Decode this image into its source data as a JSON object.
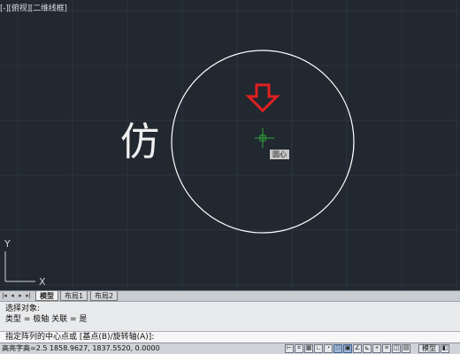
{
  "viewport": {
    "label": "[-][俯视][二维线框]",
    "side_text": "仿",
    "osnap_tooltip": "圆心",
    "ucs_x_label": "X",
    "ucs_y_label": "Y",
    "colors": {
      "background": "#212830",
      "grid": "#2b3440",
      "circle": "#ffffff",
      "marker": "#e02020",
      "cursor": "#2faa3a"
    }
  },
  "layout_tabs": {
    "nav_icons": [
      "first-tab-icon",
      "prev-tab-icon",
      "next-tab-icon",
      "last-tab-icon"
    ],
    "tabs": [
      {
        "label": "模型",
        "active": true
      },
      {
        "label": "布局1",
        "active": false
      },
      {
        "label": "布局2",
        "active": false
      }
    ]
  },
  "command": {
    "history": [
      "选择对象:",
      "类型 = 极轴  关联 = 是"
    ],
    "prompt": "指定阵列的中心点或 [基点(B)/旋转轴(A)]:"
  },
  "status_bar": {
    "coordinates_text": "高亮字高=2.5  1858.9627, 1837.5520, 0.0000",
    "model_button": "模型",
    "toggle_icons": [
      "infer-icon",
      "snap-icon",
      "grid-icon",
      "ortho-icon",
      "polar-icon",
      "osnap-icon",
      "3dosnap-icon",
      "otrack-icon",
      "ducs-icon",
      "dyn-icon",
      "lineweight-icon",
      "transparency-icon",
      "qp-icon",
      "sc-icon"
    ]
  }
}
